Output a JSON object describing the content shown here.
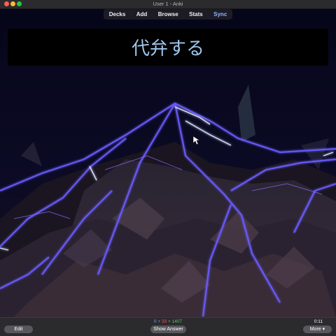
{
  "window": {
    "title": "User 1 - Anki"
  },
  "menu": {
    "items": [
      {
        "label": "Decks"
      },
      {
        "label": "Add"
      },
      {
        "label": "Browse"
      },
      {
        "label": "Stats"
      },
      {
        "label": "Sync"
      }
    ]
  },
  "card": {
    "question": "代弁する"
  },
  "counts": {
    "new": "0",
    "learning": "33",
    "review": "1407",
    "separator": "+"
  },
  "timer": "0:11",
  "buttons": {
    "edit": "Edit",
    "show_answer": "Show Answer",
    "more": "More ▾"
  },
  "colors": {
    "accent": "#8fb8ff",
    "new_count": "#6aa6ff",
    "learning_count": "#ff5555",
    "review_count": "#5fc46e",
    "card_text": "#9ec6ee"
  }
}
